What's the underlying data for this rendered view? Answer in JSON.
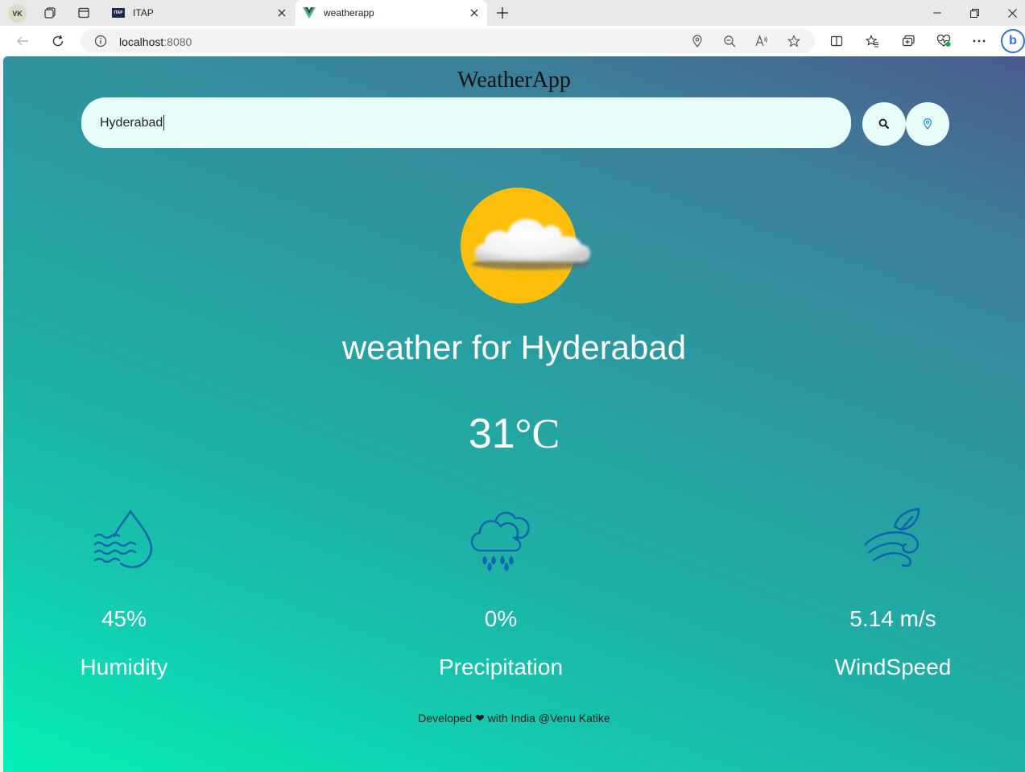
{
  "browser": {
    "profile_initials": "VK",
    "tabs": [
      {
        "title": "ITAP",
        "active": false
      },
      {
        "title": "weatherapp",
        "active": true
      }
    ],
    "url_host": "localhost",
    "url_port": ":8080"
  },
  "app": {
    "title": "WeatherApp",
    "search": {
      "value": "Hyderabad",
      "placeholder": ""
    },
    "buttons": {
      "search_icon": "search-icon",
      "location_icon": "location-pin-icon"
    },
    "weather": {
      "icon": "sun-behind-cloud-icon",
      "heading": "weather for Hyderabad",
      "temperature": "31",
      "unit": "°C"
    },
    "stats": [
      {
        "icon": "humidity-icon",
        "value": "45%",
        "label": "Humidity"
      },
      {
        "icon": "rain-cloud-icon",
        "value": "0%",
        "label": "Precipitation"
      },
      {
        "icon": "wind-icon",
        "value": "5.14 m/s",
        "label": "WindSpeed"
      }
    ],
    "footer": {
      "before": "Developed",
      "heart": "❤",
      "after": "with India @Venu Katike"
    }
  },
  "colors": {
    "gradient_top": "#4a5b8e",
    "gradient_bottom": "#05f0b8",
    "search_bg": "#e6fdf9",
    "sun": "#fbbf0b",
    "stat_icon": "#0d63b0"
  }
}
